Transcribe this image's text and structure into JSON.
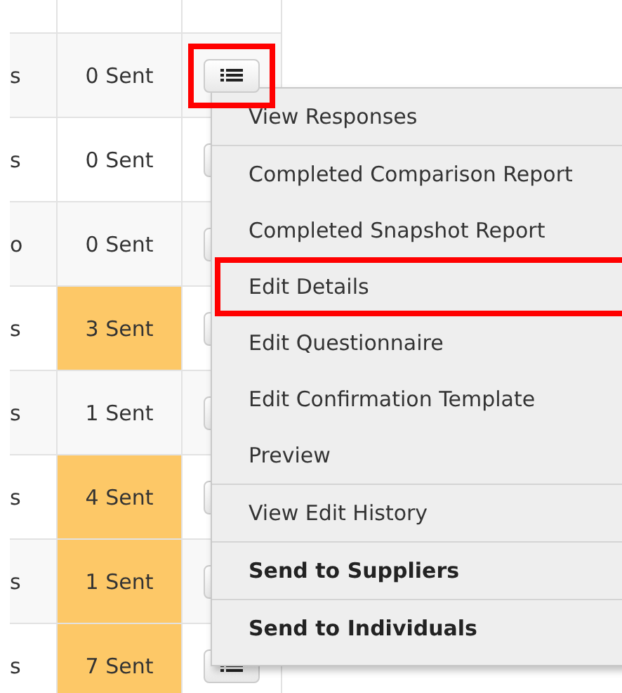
{
  "table": {
    "rows": [
      {
        "column_1": "s",
        "sent": "0 Sent",
        "highlighted": false,
        "button_marked": true
      },
      {
        "column_1": "s",
        "sent": "0 Sent",
        "highlighted": false,
        "button_marked": false
      },
      {
        "column_1": "o",
        "sent": "0 Sent",
        "highlighted": false,
        "button_marked": false
      },
      {
        "column_1": "s",
        "sent": "3 Sent",
        "highlighted": true,
        "button_marked": false
      },
      {
        "column_1": "s",
        "sent": "1 Sent",
        "highlighted": false,
        "button_marked": false
      },
      {
        "column_1": "s",
        "sent": "4 Sent",
        "highlighted": true,
        "button_marked": false
      },
      {
        "column_1": "s",
        "sent": "1 Sent",
        "highlighted": true,
        "button_marked": false
      },
      {
        "column_1": "s",
        "sent": "7 Sent",
        "highlighted": true,
        "button_marked": false
      }
    ]
  },
  "menu": {
    "items": [
      {
        "label": "View Responses",
        "bold": false,
        "divider_after": true,
        "marked": false
      },
      {
        "label": "Completed Comparison Report",
        "bold": false,
        "divider_after": false,
        "marked": false
      },
      {
        "label": "Completed Snapshot Report",
        "bold": false,
        "divider_after": false,
        "marked": false
      },
      {
        "label": "Edit Details",
        "bold": false,
        "divider_after": false,
        "marked": true
      },
      {
        "label": "Edit Questionnaire",
        "bold": false,
        "divider_after": false,
        "marked": false
      },
      {
        "label": "Edit Confirmation Template",
        "bold": false,
        "divider_after": false,
        "marked": false
      },
      {
        "label": "Preview",
        "bold": false,
        "divider_after": true,
        "marked": false
      },
      {
        "label": "View Edit History",
        "bold": false,
        "divider_after": true,
        "marked": false
      },
      {
        "label": "Send to Suppliers",
        "bold": true,
        "divider_after": true,
        "marked": false
      },
      {
        "label": "Send to Individuals",
        "bold": true,
        "divider_after": false,
        "marked": false
      }
    ]
  }
}
